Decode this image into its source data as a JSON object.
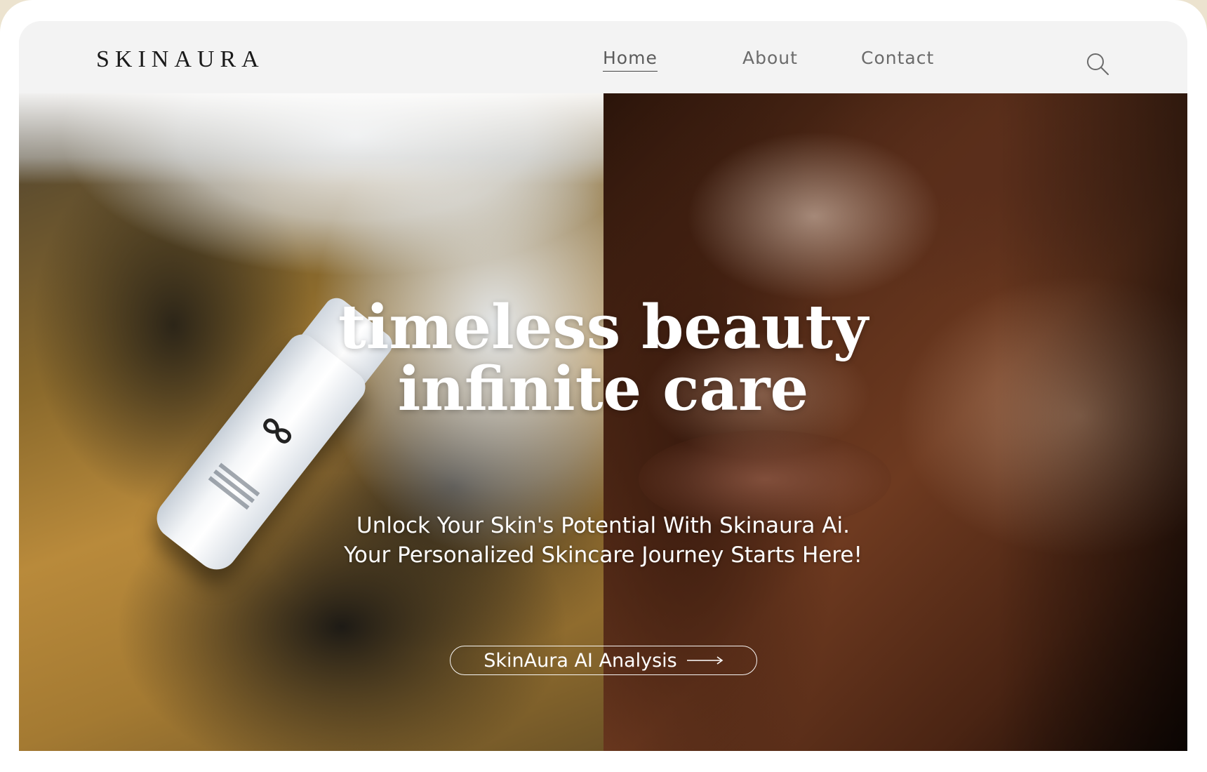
{
  "brand": {
    "logo": "SKINAURA"
  },
  "nav": {
    "links": [
      {
        "label": "Home",
        "active": true
      },
      {
        "label": "About",
        "active": false
      },
      {
        "label": "Contact",
        "active": false
      }
    ],
    "search_icon": "search-icon"
  },
  "hero": {
    "headline_line1": "timeless beauty",
    "headline_line2": "infinite care",
    "subtitle_line1": "Unlock Your Skin's Potential With Skinaura Ai.",
    "subtitle_line2": "Your Personalized Skincare Journey Starts Here!",
    "cta_label": "SkinAura AI Analysis",
    "cta_icon": "arrow-right-icon",
    "left_image": "skincare-bottle-on-sand",
    "right_image": "glowing-skin-face-closeup"
  },
  "colors": {
    "page_bg": "#ece3cf",
    "nav_bg": "#f3f3f3",
    "text_dark": "#1a1a1a",
    "hero_text": "#ffffff"
  }
}
